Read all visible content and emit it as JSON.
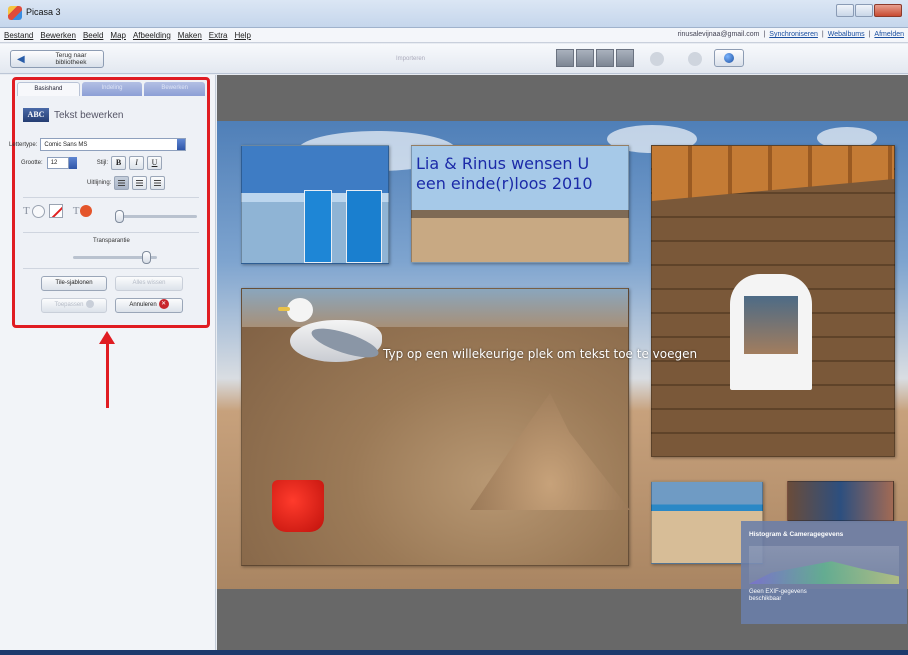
{
  "window": {
    "title": "Picasa 3"
  },
  "menu": {
    "items": [
      "Bestand",
      "Bewerken",
      "Beeld",
      "Map",
      "Afbeelding",
      "Maken",
      "Extra",
      "Help"
    ],
    "account_email": "rinusalevijnaa@gmail.com",
    "links": [
      "Synchroniseren",
      "Webalbums",
      "Afmelden"
    ],
    "separator": "|"
  },
  "toolbar": {
    "back_label": "Terug naar bibliotheek",
    "center_label": "Importeren"
  },
  "panel": {
    "tabs": [
      "Basishand",
      "Indeling",
      "Bewerken"
    ],
    "text_edit_title": "Tekst bewerken",
    "text_icon": "ABC",
    "font_label": "Lettertype:",
    "font_value": "Comic Sans MS",
    "size_label": "Grootte:",
    "size_value": "12",
    "style_label": "Stijl:",
    "bold": "B",
    "italic": "I",
    "underline": "U",
    "align_label": "Uitlijning:",
    "t_glyph": "T",
    "transparency_label": "Transparantie",
    "transparency_level": 0.92,
    "buttons": {
      "tile": "Tile-sjablonen",
      "layout": "Alles wissen",
      "preview": "Toepassen",
      "cancel": "Annuleren"
    }
  },
  "collage": {
    "title_text": "Lia & Rinus wensen U een einde(r)loos 2010",
    "prompt_text": "Typ op een willekeurige plek om tekst toe te voegen"
  },
  "histogram": {
    "title": "Histogram & Cameragegevens",
    "note": "Geen EXIF-gegevens beschikbaar"
  },
  "colors": {
    "highlight": "#e01c22",
    "accent": "#2f56a8",
    "title_text": "#1b2aa8"
  },
  "icons": [
    "back-arrow-icon",
    "globe-icon",
    "abc-text-icon",
    "no-fill-icon",
    "red-color-dot-icon",
    "cancel-x-icon"
  ]
}
